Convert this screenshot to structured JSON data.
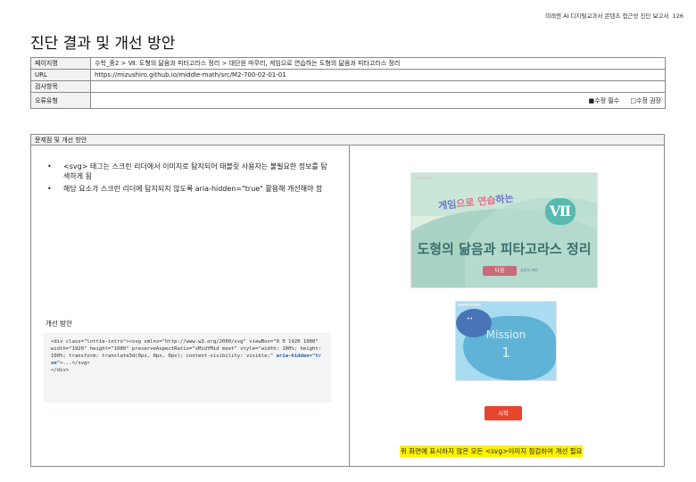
{
  "header": {
    "note": "미래엔 AI 디지털교과서 콘텐츠 접근성 진단 보고서",
    "page_number": "126"
  },
  "title": "진단 결과 및 개선 방안",
  "info_table": {
    "rows": [
      {
        "label": "페이지명",
        "value": "수학_중2 > Ⅶ. 도형의 닮음과 피타고라스 정리 > 대단원 마무리, 게임으로 연습하는 도형의 닮음과 피타고라스 정리"
      },
      {
        "label": "URL",
        "value": "https://mizushiro.github.io/middle-math/src/M2-700-02-01-01"
      },
      {
        "label": "검사항목",
        "value": ""
      },
      {
        "label": "오류유형",
        "value": ""
      }
    ],
    "checkbox_required": "■수정 필수",
    "checkbox_recommended": "□수정 권장"
  },
  "problem": {
    "heading": "문제점 및 개선 방안",
    "bullets": [
      "<svg> 태그는 스크린 리더에서 이미지로 탐지되어 태블릿 사용자는 불필요한 정보를 탐색하게 됨",
      "해당 요소가 스크린 리더에 탐지되지 않도록 aria-hidden=\"true\" 활용해 개선해야 함"
    ],
    "fix_label": "개선 방안",
    "code_before": "<div class=\"lottie-intro\"><svg xmlns=\"http://www.w3.org/2000/svg\" viewBox=\"0 0 1920 1080\" width=\"1920\" height=\"1080\" preserveAspectRatio=\"xMidYMid meet\" style=\"width: 100%; height: 100%; transform: translate3d(0px, 0px, 0px); content-visibility: visible;\" ",
    "code_highlight": "aria-hidden=\"true\"",
    "code_after": ">...</svg>\n</div>",
    "screenshot1": {
      "game_title_part1": "게임",
      "game_title_part2": "으로 ",
      "game_title_part3": "연습",
      "game_title_part4": "하는",
      "roman": "Ⅶ",
      "subtitle": "도형의 닮음과 피타고라스 정리",
      "next_button": "다음",
      "sound_label": "사운드 켜기"
    },
    "screenshot2": {
      "eyes": "••",
      "mission": "Mission",
      "mission_number": "1"
    },
    "start_button": "시작",
    "note": "위 화면에 표시하지 않은 모든 <svg>이미지 점검하여 개선 필요"
  },
  "colors": {
    "highlight": "#fff200",
    "start_button": "#e8452f",
    "code_highlight": "#1f5fb0"
  }
}
